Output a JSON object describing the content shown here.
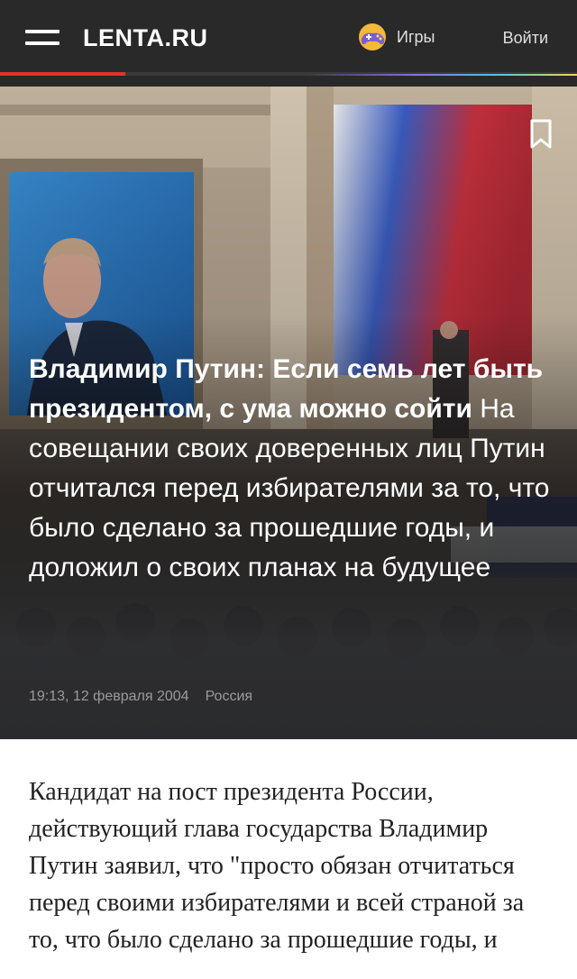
{
  "header": {
    "logo": "LENTA.RU",
    "games_label": "Игры",
    "login_label": "Войти",
    "accent_color": "#e4322b",
    "background_color": "#292929"
  },
  "article": {
    "title": "Владимир Путин: Если семь лет быть президентом, с ума можно сойти",
    "lead": "На совещании своих доверенных лиц Путин отчитался перед избирателями за то, что было сделано за прошедшие годы, и доложил о своих планах на будущее",
    "time": "19:13, 12 февраля 2004",
    "rubric": "Россия",
    "body": "Кандидат на пост президента России, действующий глава государства Владимир Путин заявил, что \"просто обязан отчитаться перед своими избирателями и всей страной за то, что было сделано за прошедшие годы, и"
  },
  "icons": {
    "menu": "hamburger-icon",
    "games": "gamepad-icon",
    "bookmark": "bookmark-icon"
  }
}
